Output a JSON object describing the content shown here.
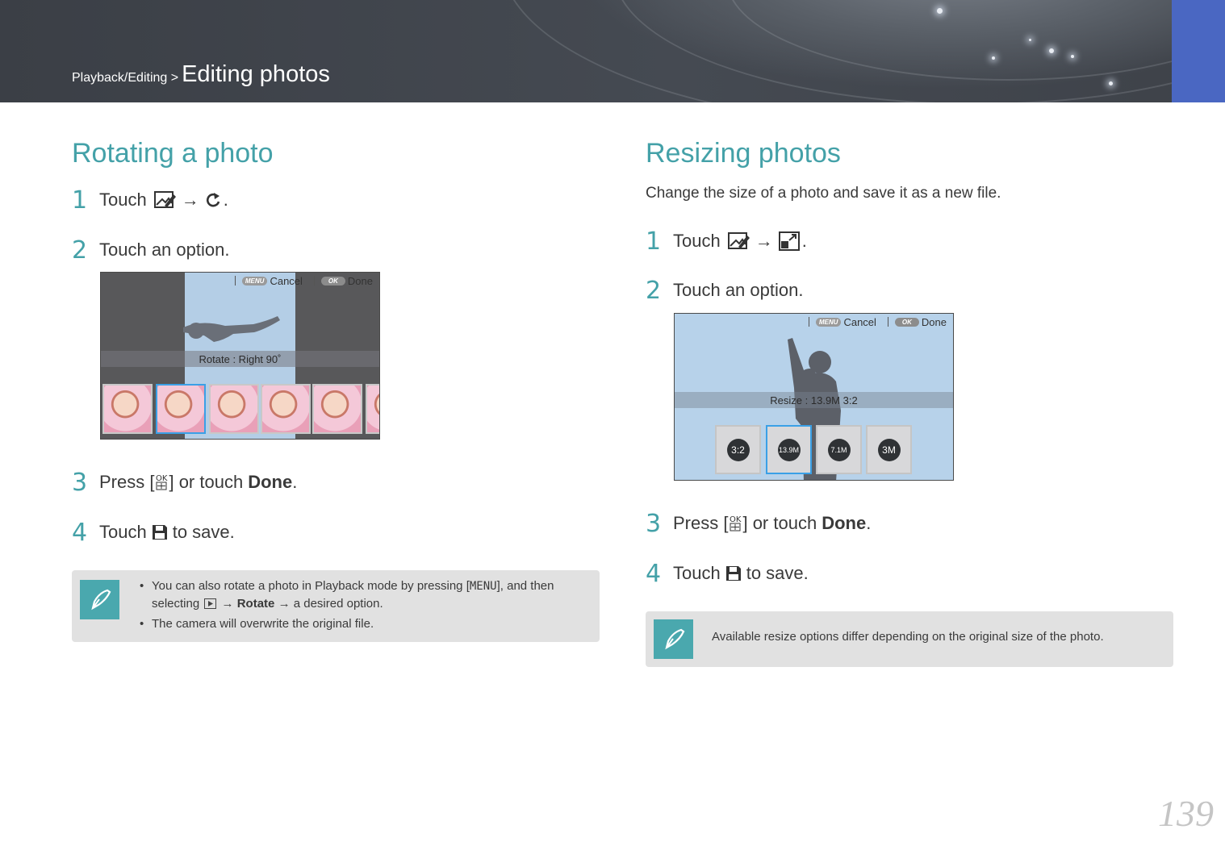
{
  "header": {
    "breadcrumb_small": "Playback/Editing >",
    "breadcrumb_title": "Editing photos"
  },
  "colors": {
    "accent": "#44a1a8",
    "tab": "#4a67c2",
    "header": "#41464d",
    "selection": "#3aa0e6"
  },
  "rotate": {
    "title": "Rotating a photo",
    "steps": [
      {
        "num": "1",
        "text_before": "Touch",
        "text_after": ".",
        "icons": [
          "edit-photo-icon",
          "rotate-icon"
        ]
      },
      {
        "num": "2",
        "text": "Touch an option."
      },
      {
        "num": "3",
        "text_before": "Press [",
        "text_middle": "] or touch",
        "bold": "Done",
        "text_after": ".",
        "icons": [
          "ok-button-icon"
        ]
      },
      {
        "num": "4",
        "text_before": "Touch",
        "text_after": "to save.",
        "icons": [
          "save-icon"
        ]
      }
    ],
    "screen": {
      "cancel": "Cancel",
      "done": "Done",
      "menu_pill": "MENU",
      "ok_pill": "OK",
      "status": "Rotate : Right 90˚"
    },
    "notes": [
      {
        "before": "You can also rotate a photo in Playback mode by pressing [",
        "menu": "MENU",
        "middle": "], and then selecting",
        "arrow1": "→",
        "bold": "Rotate",
        "after": "→ a desired option."
      },
      {
        "text": "The camera will overwrite the original file."
      }
    ]
  },
  "resize": {
    "title": "Resizing photos",
    "intro": "Change the size of a photo and save it as a new file.",
    "steps": [
      {
        "num": "1",
        "text_before": "Touch",
        "text_after": ".",
        "icons": [
          "edit-photo-icon",
          "resize-icon"
        ]
      },
      {
        "num": "2",
        "text": "Touch an option."
      },
      {
        "num": "3",
        "text_before": "Press [",
        "text_middle": "] or touch",
        "bold": "Done",
        "text_after": ".",
        "icons": [
          "ok-button-icon"
        ]
      },
      {
        "num": "4",
        "text_before": "Touch",
        "text_after": "to save.",
        "icons": [
          "save-icon"
        ]
      }
    ],
    "screen": {
      "cancel": "Cancel",
      "done": "Done",
      "menu_pill": "MENU",
      "ok_pill": "OK",
      "status": "Resize : 13.9M 3:2",
      "options": [
        "3:2",
        "13.9M",
        "7.1M",
        "3M"
      ]
    },
    "note": "Available resize options differ depending on the original size of the photo."
  },
  "page_number": "139",
  "arrow": "→"
}
